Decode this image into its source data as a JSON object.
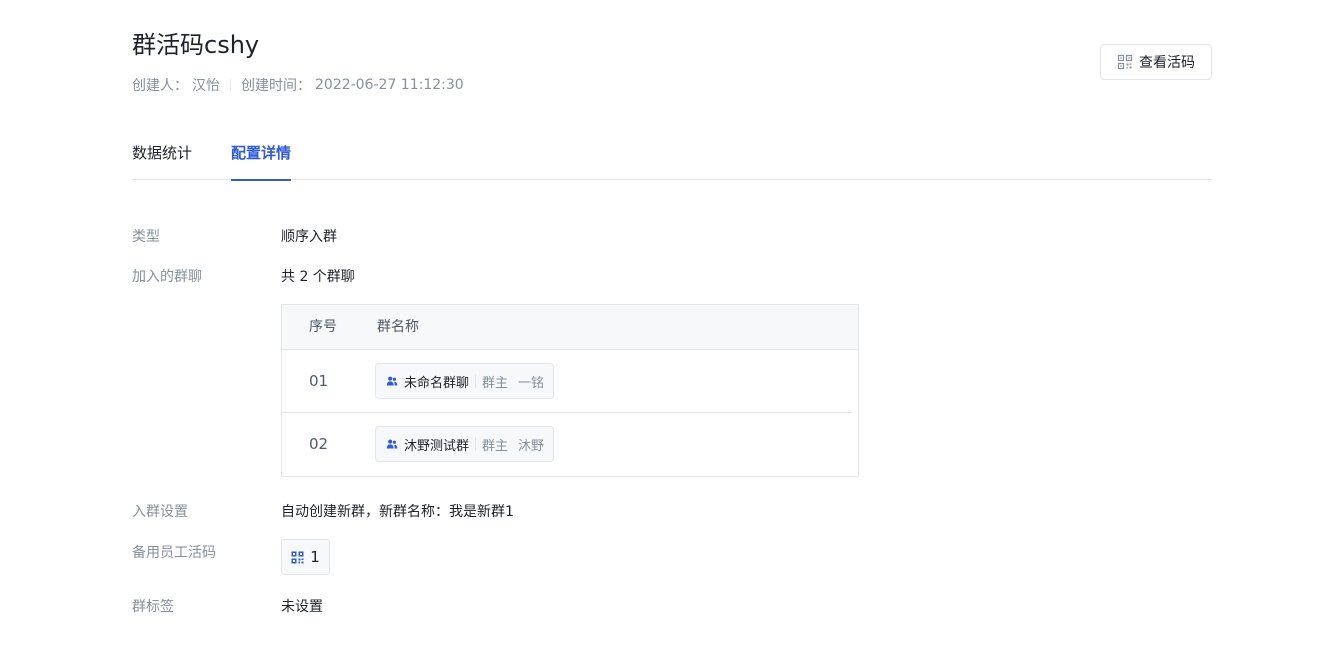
{
  "header": {
    "title": "群活码cshy",
    "creator_label": "创建人：",
    "creator_name": "汉怡",
    "created_time_label": "创建时间：",
    "created_time": "2022-06-27 11:12:30",
    "view_code_button": "查看活码"
  },
  "tabs": [
    {
      "label": "数据统计",
      "active": false
    },
    {
      "label": "配置详情",
      "active": true
    }
  ],
  "details": {
    "type_label": "类型",
    "type_value": "顺序入群",
    "groups_label": "加入的群聊",
    "groups_count_text": "共 2 个群聊",
    "table": {
      "headers": [
        "序号",
        "群名称"
      ],
      "rows": [
        {
          "index": "01",
          "group_name": "未命名群聊",
          "owner_label": "群主",
          "owner_name": "一铭"
        },
        {
          "index": "02",
          "group_name": "沐野测试群",
          "owner_label": "群主",
          "owner_name": "沐野"
        }
      ]
    },
    "join_settings_label": "入群设置",
    "join_settings_value": "自动创建新群，新群名称：我是新群1",
    "backup_code_label": "备用员工活码",
    "backup_code_count": "1",
    "group_tags_label": "群标签",
    "group_tags_value": "未设置"
  },
  "colors": {
    "accent": "#2f5bd8",
    "text_primary": "#1d2129",
    "text_secondary": "#86909c",
    "border": "#e5e6eb",
    "table_header_bg": "#f7f8fa"
  },
  "icons": {
    "view_code": "qr-code-icon",
    "group_member": "users-icon",
    "backup_code": "qr-code-icon"
  }
}
